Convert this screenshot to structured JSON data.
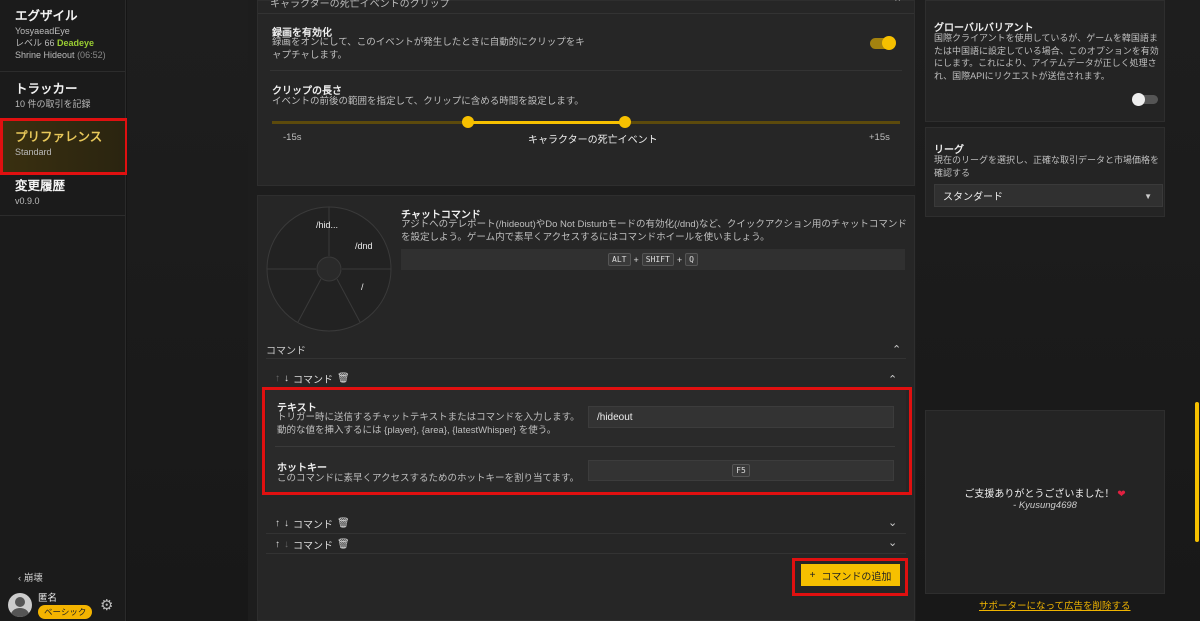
{
  "sidebar": {
    "profile": {
      "title": "エグザイル",
      "name": "YosyaeadEye",
      "level_prefix": "レベル 66",
      "class": "Deadeye",
      "location": "Shrine Hideout",
      "time": "(06:52)"
    },
    "tracker": {
      "title": "トラッカー",
      "sub": "10 件の取引を記録"
    },
    "preferences": {
      "title": "プリファレンス",
      "sub": "Standard"
    },
    "changelog": {
      "title": "変更履歴",
      "sub": "v0.9.0"
    },
    "collapse_label": "崩壊",
    "user": {
      "name": "匿名",
      "badge": "ベーシック"
    }
  },
  "clip_section": {
    "header": "キャラクターの死亡イベントのクリップ",
    "record_title": "録画を有効化",
    "record_desc": "録画をオンにして、このイベントが発生したときに自動的にクリップをキャプチャします。",
    "record_enabled": true,
    "length_title": "クリップの長さ",
    "length_desc": "イベントの前後の範囲を指定して、クリップに含める時間を設定します。",
    "slider_min_label": "-15s",
    "slider_center_label": "キャラクターの死亡イベント",
    "slider_max_label": "+15s"
  },
  "chat_section": {
    "title": "チャットコマンド",
    "desc": "アジトへのテレポート(/hideout)やDo Not Disturbモードの有効化(/dnd)など、クイックアクション用のチャットコマンドを設定しよう。ゲーム内で素早くアクセスするにはコマンドホイールを使いましょう。",
    "wheel_labels": [
      "/hid...",
      "/dnd",
      "/"
    ],
    "hotkey_keys": [
      "ALT",
      "SHIFT",
      "Q"
    ],
    "commands_label": "コマンド",
    "command_row_label": "コマンド",
    "text_title": "テキスト",
    "text_desc": "トリガー時に送信するチャットテキストまたはコマンドを入力します。動的な値を挿入するには {player}, {area}, {latestWhisper} を使う。",
    "text_value": "/hideout",
    "hotkey_title": "ホットキー",
    "hotkey_desc": "このコマンドに素早くアクセスするためのホットキーを割り当てます。",
    "hotkey_value": "F5",
    "add_button": "コマンドの追加"
  },
  "right_panel": {
    "global_title": "グローバルバリアント",
    "global_desc": "国際クライアントを使用しているが、ゲームを韓国語または中国語に設定している場合、このオプションを有効にします。これにより、アイテムデータが正しく処理され、国際APIにリクエストが送信されます。",
    "global_enabled": false,
    "league_title": "リーグ",
    "league_desc": "現在のリーグを選択し、正確な取引データと市場価格を確認する",
    "league_value": "スタンダード",
    "thanks": "ご支援ありがとうございました！",
    "supporter": "- Kyusung4698",
    "remove_ads_link": "サポーターになって広告を削除する"
  },
  "colors": {
    "accent": "#f6c000",
    "highlight_box": "#e01010",
    "class_color": "#9acd32"
  }
}
